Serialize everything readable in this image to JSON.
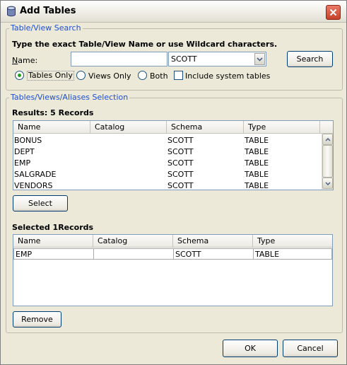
{
  "window": {
    "title": "Add Tables",
    "close_label": "✕"
  },
  "search_group": {
    "legend": "Table/View Search",
    "instruction": "Type the exact Table/View Name or use Wildcard characters.",
    "name_label": "Name:",
    "name_value": "",
    "schema_value": "SCOTT",
    "search_button": "Search",
    "options": {
      "tables_only": "Tables Only",
      "views_only": "Views Only",
      "both": "Both",
      "selected": "tables_only",
      "include_system_tables": "Include system tables",
      "include_system_tables_checked": false
    }
  },
  "selection_group": {
    "legend": "Tables/Views/Aliases Selection",
    "results_label": "Results: 5 Records",
    "columns": [
      "Name",
      "Catalog",
      "Schema",
      "Type"
    ],
    "rows": [
      {
        "name": "BONUS",
        "catalog": "",
        "schema": "SCOTT",
        "type": "TABLE"
      },
      {
        "name": "DEPT",
        "catalog": "",
        "schema": "SCOTT",
        "type": "TABLE"
      },
      {
        "name": "EMP",
        "catalog": "",
        "schema": "SCOTT",
        "type": "TABLE"
      },
      {
        "name": "SALGRADE",
        "catalog": "",
        "schema": "SCOTT",
        "type": "TABLE"
      },
      {
        "name": "VENDORS",
        "catalog": "",
        "schema": "SCOTT",
        "type": "TABLE"
      }
    ],
    "select_button": "Select",
    "selected_label": "Selected 1Records",
    "selected_columns": [
      "Name",
      "Catalog",
      "Schema",
      "Type"
    ],
    "selected_rows": [
      {
        "name": "EMP",
        "catalog": "",
        "schema": "SCOTT",
        "type": "TABLE"
      }
    ],
    "remove_button": "Remove"
  },
  "footer": {
    "ok_button": "OK",
    "cancel_button": "Cancel"
  },
  "colors": {
    "legend_text": "#1c4ed8",
    "dialog_bg": "#ece9d8",
    "radio_dot": "#21a121"
  }
}
